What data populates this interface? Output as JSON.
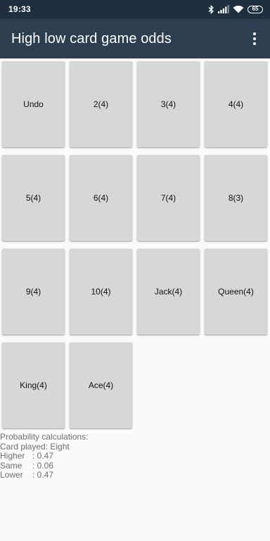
{
  "status_bar": {
    "time": "19:33",
    "battery": "65",
    "icons": [
      "bluetooth-icon",
      "signal-icon",
      "wifi-icon",
      "battery-icon"
    ]
  },
  "app_bar": {
    "title": "High low card game odds",
    "menu_icon": "more-vert-icon"
  },
  "cards": [
    {
      "label": "Undo"
    },
    {
      "label": "2(4)"
    },
    {
      "label": "3(4)"
    },
    {
      "label": "4(4)"
    },
    {
      "label": "5(4)"
    },
    {
      "label": "6(4)"
    },
    {
      "label": "7(4)"
    },
    {
      "label": "8(3)"
    },
    {
      "label": "9(4)"
    },
    {
      "label": "10(4)"
    },
    {
      "label": "Jack(4)"
    },
    {
      "label": "Queen(4)"
    },
    {
      "label": "King(4)"
    },
    {
      "label": "Ace(4)"
    }
  ],
  "results": {
    "heading": "Probability calculations:",
    "card_played": "Card played: Eight",
    "higher_label": "Higher",
    "higher_value": ": 0.47",
    "same_label": "Same",
    "same_value": ": 0.06",
    "lower_label": "Lower",
    "lower_value": ": 0.47"
  },
  "colors": {
    "status_bar": "#1f2f3f",
    "app_bar": "#2d3e50",
    "card": "#d6d7d7",
    "background": "#fafafa"
  }
}
